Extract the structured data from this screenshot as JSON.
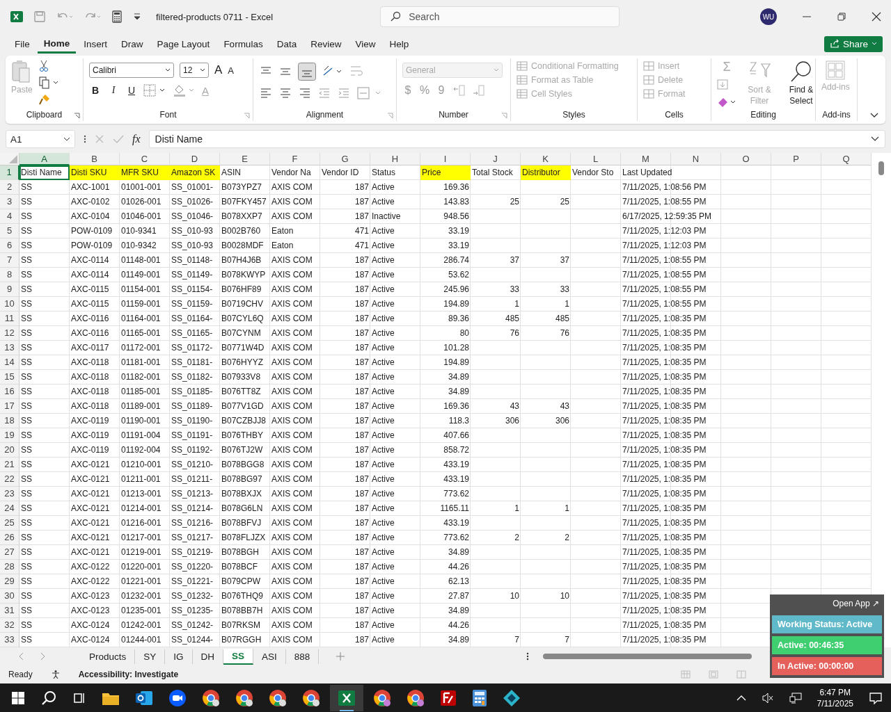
{
  "window": {
    "title": "filtered-products 0711  -  Excel",
    "search_placeholder": "Search",
    "avatar": "WU"
  },
  "menu_tabs": [
    {
      "label": "File",
      "selected": false
    },
    {
      "label": "Home",
      "selected": true
    },
    {
      "label": "Insert",
      "selected": false
    },
    {
      "label": "Draw",
      "selected": false
    },
    {
      "label": "Page Layout",
      "selected": false
    },
    {
      "label": "Formulas",
      "selected": false
    },
    {
      "label": "Data",
      "selected": false
    },
    {
      "label": "Review",
      "selected": false
    },
    {
      "label": "View",
      "selected": false
    },
    {
      "label": "Help",
      "selected": false
    }
  ],
  "share_button": "Share",
  "ribbon": {
    "paste": {
      "label": "Paste",
      "disabled": true
    },
    "clipboard_label": "Clipboard",
    "font_name": "Calibri",
    "font_size": "12",
    "font_size_buttons": [
      "A",
      "A"
    ],
    "style_buttons": [
      "B",
      "I",
      "U"
    ],
    "font_color_button": "A",
    "font_label": "Font",
    "alignment_label": "Alignment",
    "number_format": {
      "value": "General",
      "disabled": true
    },
    "number_buttons": [
      "$",
      "%",
      "9"
    ],
    "number_label": "Number",
    "styles": [
      {
        "label": "Conditional Formatting",
        "disabled": true
      },
      {
        "label": "Format as Table",
        "disabled": true
      },
      {
        "label": "Cell Styles",
        "disabled": true
      }
    ],
    "styles_label": "Styles",
    "cells": [
      {
        "label": "Insert",
        "disabled": true
      },
      {
        "label": "Delete",
        "disabled": true
      },
      {
        "label": "Format",
        "disabled": true
      }
    ],
    "cells_label": "Cells",
    "editing": [
      {
        "label": "Sort & Filter",
        "disabled": true
      },
      {
        "label": "Find & Select",
        "disabled": false
      }
    ],
    "sum_symbol": "Σ",
    "editing_label": "Editing",
    "addins": {
      "label": "Add-ins",
      "disabled": true
    },
    "addins_label": "Add-ins"
  },
  "formula_bar": {
    "name_box": "A1",
    "function_label": "fx",
    "value": "Disti Name"
  },
  "column_letters": [
    "A",
    "B",
    "C",
    "D",
    "E",
    "F",
    "G",
    "H",
    "I",
    "J",
    "K",
    "L",
    "M",
    "N",
    "O",
    "P",
    "Q"
  ],
  "header": {
    "number": "1",
    "cells": [
      {
        "text": "Disti Name",
        "highlighted": false,
        "selected": true
      },
      {
        "text": "Disti SKU",
        "highlighted": true,
        "selected": false
      },
      {
        "text": "MFR SKU",
        "highlighted": true,
        "selected": false
      },
      {
        "text": "Amazon SK",
        "highlighted": true,
        "selected": false
      },
      {
        "text": "ASIN",
        "highlighted": false,
        "selected": false
      },
      {
        "text": "Vendor Na",
        "highlighted": false,
        "selected": false
      },
      {
        "text": "Vendor ID",
        "highlighted": false,
        "selected": false
      },
      {
        "text": "Status",
        "highlighted": false,
        "selected": false
      },
      {
        "text": "Price",
        "highlighted": true,
        "selected": false
      },
      {
        "text": "Total Stock",
        "highlighted": false,
        "selected": false
      },
      {
        "text": "Distributor",
        "highlighted": true,
        "selected": false
      },
      {
        "text": "Vendor Sto",
        "highlighted": false,
        "selected": false
      },
      {
        "text": "Last Updated",
        "highlighted": false,
        "selected": false
      }
    ]
  },
  "rows": [
    {
      "number": "2",
      "cells": [
        "SS",
        "AXC-1001",
        "01001-001",
        "SS_01001-",
        "B073YPZ7",
        "AXIS COM",
        "187",
        "Active",
        "169.36",
        null,
        null,
        null,
        "7/11/2025, 1:08:56 PM"
      ]
    },
    {
      "number": "3",
      "cells": [
        "SS",
        "AXC-0102",
        "01026-001",
        "SS_01026-",
        "B07FKY457",
        "AXIS COM",
        "187",
        "Active",
        "143.83",
        "25",
        "25",
        null,
        "7/11/2025, 1:08:55 PM"
      ]
    },
    {
      "number": "4",
      "cells": [
        "SS",
        "AXC-0104",
        "01046-001",
        "SS_01046-",
        "B078XXP7",
        "AXIS COM",
        "187",
        "Inactive",
        "948.56",
        null,
        null,
        null,
        "6/17/2025, 12:59:35 PM"
      ]
    },
    {
      "number": "5",
      "cells": [
        "SS",
        "POW-0109",
        "010-9341",
        "SS_010-93",
        "B002B760",
        "Eaton",
        "471",
        "Active",
        "33.19",
        null,
        null,
        null,
        "7/11/2025, 1:12:03 PM"
      ]
    },
    {
      "number": "6",
      "cells": [
        "SS",
        "POW-0109",
        "010-9342",
        "SS_010-93",
        "B0028MDF",
        "Eaton",
        "471",
        "Active",
        "33.19",
        null,
        null,
        null,
        "7/11/2025, 1:12:03 PM"
      ]
    },
    {
      "number": "7",
      "cells": [
        "SS",
        "AXC-0114",
        "01148-001",
        "SS_01148-",
        "B07H4J6B",
        "AXIS COM",
        "187",
        "Active",
        "286.74",
        "37",
        "37",
        null,
        "7/11/2025, 1:08:55 PM"
      ]
    },
    {
      "number": "8",
      "cells": [
        "SS",
        "AXC-0114",
        "01149-001",
        "SS_01149-",
        "B078KWYP",
        "AXIS COM",
        "187",
        "Active",
        "53.62",
        null,
        null,
        null,
        "7/11/2025, 1:08:55 PM"
      ]
    },
    {
      "number": "9",
      "cells": [
        "SS",
        "AXC-0115",
        "01154-001",
        "SS_01154-",
        "B076HF89",
        "AXIS COM",
        "187",
        "Active",
        "245.96",
        "33",
        "33",
        null,
        "7/11/2025, 1:08:55 PM"
      ]
    },
    {
      "number": "10",
      "cells": [
        "SS",
        "AXC-0115",
        "01159-001",
        "SS_01159-",
        "B0719CHV",
        "AXIS COM",
        "187",
        "Active",
        "194.89",
        "1",
        "1",
        null,
        "7/11/2025, 1:08:55 PM"
      ]
    },
    {
      "number": "11",
      "cells": [
        "SS",
        "AXC-0116",
        "01164-001",
        "SS_01164-",
        "B07CYL6Q",
        "AXIS COM",
        "187",
        "Active",
        "89.36",
        "485",
        "485",
        null,
        "7/11/2025, 1:08:35 PM"
      ]
    },
    {
      "number": "12",
      "cells": [
        "SS",
        "AXC-0116",
        "01165-001",
        "SS_01165-",
        "B07CYNM",
        "AXIS COM",
        "187",
        "Active",
        "80",
        "76",
        "76",
        null,
        "7/11/2025, 1:08:35 PM"
      ]
    },
    {
      "number": "13",
      "cells": [
        "SS",
        "AXC-0117",
        "01172-001",
        "SS_01172-",
        "B0771W4D",
        "AXIS COM",
        "187",
        "Active",
        "101.28",
        null,
        null,
        null,
        "7/11/2025, 1:08:35 PM"
      ]
    },
    {
      "number": "14",
      "cells": [
        "SS",
        "AXC-0118",
        "01181-001",
        "SS_01181-",
        "B076HYYZ",
        "AXIS COM",
        "187",
        "Active",
        "194.89",
        null,
        null,
        null,
        "7/11/2025, 1:08:35 PM"
      ]
    },
    {
      "number": "15",
      "cells": [
        "SS",
        "AXC-0118",
        "01182-001",
        "SS_01182-",
        "B07933V8",
        "AXIS COM",
        "187",
        "Active",
        "34.89",
        null,
        null,
        null,
        "7/11/2025, 1:08:35 PM"
      ]
    },
    {
      "number": "16",
      "cells": [
        "SS",
        "AXC-0118",
        "01185-001",
        "SS_01185-",
        "B076TT8Z",
        "AXIS COM",
        "187",
        "Active",
        "34.89",
        null,
        null,
        null,
        "7/11/2025, 1:08:35 PM"
      ]
    },
    {
      "number": "17",
      "cells": [
        "SS",
        "AXC-0118",
        "01189-001",
        "SS_01189-",
        "B077V1GD",
        "AXIS COM",
        "187",
        "Active",
        "169.36",
        "43",
        "43",
        null,
        "7/11/2025, 1:08:35 PM"
      ]
    },
    {
      "number": "18",
      "cells": [
        "SS",
        "AXC-0119",
        "01190-001",
        "SS_01190-",
        "B07CZBJJ8",
        "AXIS COM",
        "187",
        "Active",
        "118.3",
        "306",
        "306",
        null,
        "7/11/2025, 1:08:35 PM"
      ]
    },
    {
      "number": "19",
      "cells": [
        "SS",
        "AXC-0119",
        "01191-004",
        "SS_01191-",
        "B076THBY",
        "AXIS COM",
        "187",
        "Active",
        "407.66",
        null,
        null,
        null,
        "7/11/2025, 1:08:35 PM"
      ]
    },
    {
      "number": "20",
      "cells": [
        "SS",
        "AXC-0119",
        "01192-004",
        "SS_01192-",
        "B076TJ2W",
        "AXIS COM",
        "187",
        "Active",
        "858.72",
        null,
        null,
        null,
        "7/11/2025, 1:08:35 PM"
      ]
    },
    {
      "number": "21",
      "cells": [
        "SS",
        "AXC-0121",
        "01210-001",
        "SS_01210-",
        "B078BGG8",
        "AXIS COM",
        "187",
        "Active",
        "433.19",
        null,
        null,
        null,
        "7/11/2025, 1:08:35 PM"
      ]
    },
    {
      "number": "22",
      "cells": [
        "SS",
        "AXC-0121",
        "01211-001",
        "SS_01211-",
        "B078BG97",
        "AXIS COM",
        "187",
        "Active",
        "433.19",
        null,
        null,
        null,
        "7/11/2025, 1:08:35 PM"
      ]
    },
    {
      "number": "23",
      "cells": [
        "SS",
        "AXC-0121",
        "01213-001",
        "SS_01213-",
        "B078BXJX",
        "AXIS COM",
        "187",
        "Active",
        "773.62",
        null,
        null,
        null,
        "7/11/2025, 1:08:35 PM"
      ]
    },
    {
      "number": "24",
      "cells": [
        "SS",
        "AXC-0121",
        "01214-001",
        "SS_01214-",
        "B078G6LN",
        "AXIS COM",
        "187",
        "Active",
        "1165.11",
        "1",
        "1",
        null,
        "7/11/2025, 1:08:35 PM"
      ]
    },
    {
      "number": "25",
      "cells": [
        "SS",
        "AXC-0121",
        "01216-001",
        "SS_01216-",
        "B078BFVJ",
        "AXIS COM",
        "187",
        "Active",
        "433.19",
        null,
        null,
        null,
        "7/11/2025, 1:08:35 PM"
      ]
    },
    {
      "number": "26",
      "cells": [
        "SS",
        "AXC-0121",
        "01217-001",
        "SS_01217-",
        "B078FLJZX",
        "AXIS COM",
        "187",
        "Active",
        "773.62",
        "2",
        "2",
        null,
        "7/11/2025, 1:08:35 PM"
      ]
    },
    {
      "number": "27",
      "cells": [
        "SS",
        "AXC-0121",
        "01219-001",
        "SS_01219-",
        "B078BGH",
        "AXIS COM",
        "187",
        "Active",
        "34.89",
        null,
        null,
        null,
        "7/11/2025, 1:08:35 PM"
      ]
    },
    {
      "number": "28",
      "cells": [
        "SS",
        "AXC-0122",
        "01220-001",
        "SS_01220-",
        "B078BCF",
        "AXIS COM",
        "187",
        "Active",
        "44.26",
        null,
        null,
        null,
        "7/11/2025, 1:08:35 PM"
      ]
    },
    {
      "number": "29",
      "cells": [
        "SS",
        "AXC-0122",
        "01221-001",
        "SS_01221-",
        "B079CPW",
        "AXIS COM",
        "187",
        "Active",
        "62.13",
        null,
        null,
        null,
        "7/11/2025, 1:08:35 PM"
      ]
    },
    {
      "number": "30",
      "cells": [
        "SS",
        "AXC-0123",
        "01232-001",
        "SS_01232-",
        "B076THQ9",
        "AXIS COM",
        "187",
        "Active",
        "27.87",
        "10",
        "10",
        null,
        "7/11/2025, 1:08:35 PM"
      ]
    },
    {
      "number": "31",
      "cells": [
        "SS",
        "AXC-0123",
        "01235-001",
        "SS_01235-",
        "B078BB7H",
        "AXIS COM",
        "187",
        "Active",
        "34.89",
        null,
        null,
        null,
        "7/11/2025, 1:08:35 PM"
      ]
    },
    {
      "number": "32",
      "cells": [
        "SS",
        "AXC-0124",
        "01242-001",
        "SS_01242-",
        "B07RKSM",
        "AXIS COM",
        "187",
        "Active",
        "44.26",
        null,
        null,
        null,
        "7/11/2025, 1:08:35 PM"
      ]
    },
    {
      "number": "33",
      "cells": [
        "SS",
        "AXC-0124",
        "01244-001",
        "SS_01244-",
        "B07RGGH",
        "AXIS COM",
        "187",
        "Active",
        "34.89",
        "7",
        "7",
        null,
        "7/11/2025, 1:08:35 PM"
      ]
    }
  ],
  "sheet_tabs": [
    {
      "label": "Products",
      "selected": false
    },
    {
      "label": "SY",
      "selected": false
    },
    {
      "label": "IG",
      "selected": false
    },
    {
      "label": "DH",
      "selected": false
    },
    {
      "label": "SS",
      "selected": true
    },
    {
      "label": "ASI",
      "selected": false
    },
    {
      "label": "888",
      "selected": false
    }
  ],
  "status_bar": {
    "mode": "Ready",
    "accessibility": "Accessibility: Investigate"
  },
  "tracker": {
    "open_app": "Open App ↗",
    "working_status": "Working Status: Active",
    "active": "Active: 00:46:35",
    "inactive": "In Active: 00:00:00"
  },
  "taskbar": {
    "time": "6:47 PM",
    "date": "7/11/2025"
  }
}
